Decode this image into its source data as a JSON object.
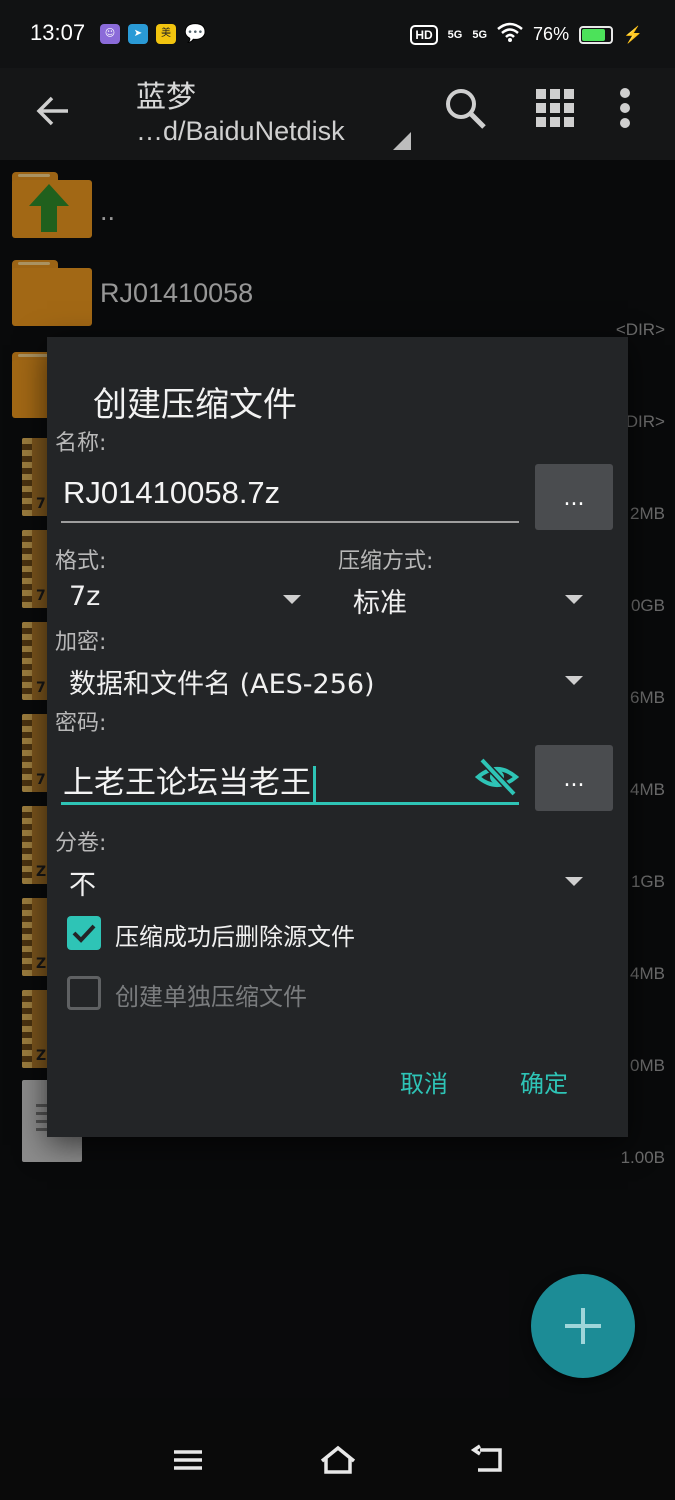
{
  "status_bar": {
    "time": "13:07",
    "hd_badge": "HD",
    "signal1": "5G",
    "signal2": "5G",
    "battery": "76%",
    "battery_level": 0.76
  },
  "toolbar": {
    "title": "蓝梦",
    "path": "…d/BaiduNetdisk"
  },
  "files": [
    {
      "name": "..",
      "type": "parent-folder"
    },
    {
      "name": "RJ01410058",
      "meta": "<DIR>",
      "type": "folder"
    },
    {
      "name": "",
      "meta": "DIR>",
      "type": "folder"
    },
    {
      "label": "7",
      "meta": "2MB",
      "type": "archive"
    },
    {
      "label": "7",
      "meta": "0GB",
      "type": "archive"
    },
    {
      "label": "7",
      "meta": "6MB",
      "type": "archive"
    },
    {
      "label": "7",
      "meta": "4MB",
      "type": "archive"
    },
    {
      "label": "Z",
      "meta": "1GB",
      "type": "archive"
    },
    {
      "label": "Z",
      "meta": "4MB",
      "type": "archive"
    },
    {
      "label": "Z",
      "meta": "0MB",
      "type": "archive"
    },
    {
      "meta": "1.00B",
      "type": "text-file"
    }
  ],
  "dialog": {
    "title": "创建压缩文件",
    "name_label": "名称:",
    "name_value": "RJ01410058.7z",
    "browse_label": "...",
    "format_label": "格式:",
    "format_value": "7z",
    "method_label": "压缩方式:",
    "method_value": "标准",
    "encryption_label": "加密:",
    "encryption_value": "数据和文件名 (AES-256)",
    "password_label": "密码:",
    "password_value": "上老王论坛当老王",
    "password_dots": "...",
    "split_label": "分卷:",
    "split_value": "不",
    "delete_source_label": "压缩成功后删除源文件",
    "delete_source_checked": true,
    "separate_label": "创建单独压缩文件",
    "separate_checked": false,
    "cancel_label": "取消",
    "ok_label": "确定"
  },
  "colors": {
    "accent": "#2ec4b6",
    "folder": "#e8961f",
    "fab": "#1c8c96"
  }
}
